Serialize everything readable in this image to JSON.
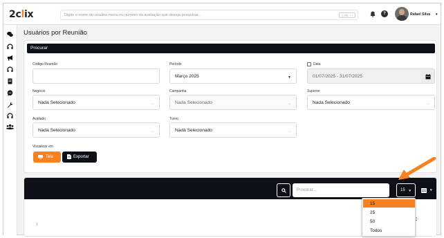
{
  "brand": {
    "logo_prefix": "2c",
    "logo_accent": "l",
    "logo_suffix": "ix",
    "accent_color": "#f58220"
  },
  "header": {
    "search_placeholder": "Digite o nome do usuário,menu ou número da avaliação que deseja pesquisar...",
    "shortcut": "CTRL + /",
    "help_label": "?",
    "user_name": "Rafael Silva"
  },
  "sidebar": {
    "icons": [
      "chat-bubbles-icon",
      "headset-icon",
      "megaphone-icon",
      "headset-icon",
      "document-icon",
      "message-icon",
      "wrench-icon",
      "headset-icon",
      "users-icon"
    ]
  },
  "page": {
    "title": "Usuários por Reunião"
  },
  "filters": {
    "header": "Procurar",
    "codigo_reuniao": {
      "label": "Código Reunião",
      "value": ""
    },
    "periodo": {
      "label": "Período",
      "value": "Março 2025"
    },
    "data": {
      "label": "Data",
      "value": "01/07/2025 - 31/07/2025",
      "checked": false
    },
    "negocio": {
      "label": "Negócio",
      "value": "Nada Selecionado"
    },
    "campanha": {
      "label": "Campanha",
      "value": "Nada Selecionado"
    },
    "superior": {
      "label": "Superior",
      "value": "Nada Selecionado"
    },
    "avaliado": {
      "label": "Avaliado",
      "value": "Nada Selecionado"
    },
    "turno": {
      "label": "Turno",
      "value": "Nada Selecionado"
    },
    "view_label": "Visualizar em",
    "btn_tela": "Tela",
    "btn_exportar": "Exportar"
  },
  "table": {
    "search_placeholder": "Procurar...",
    "page_length": "15",
    "page_length_options": [
      "15",
      "25",
      "50",
      "Todos"
    ],
    "selected_option": "15",
    "row_number": "1",
    "right_edge_chars": [
      "C",
      "/"
    ]
  }
}
